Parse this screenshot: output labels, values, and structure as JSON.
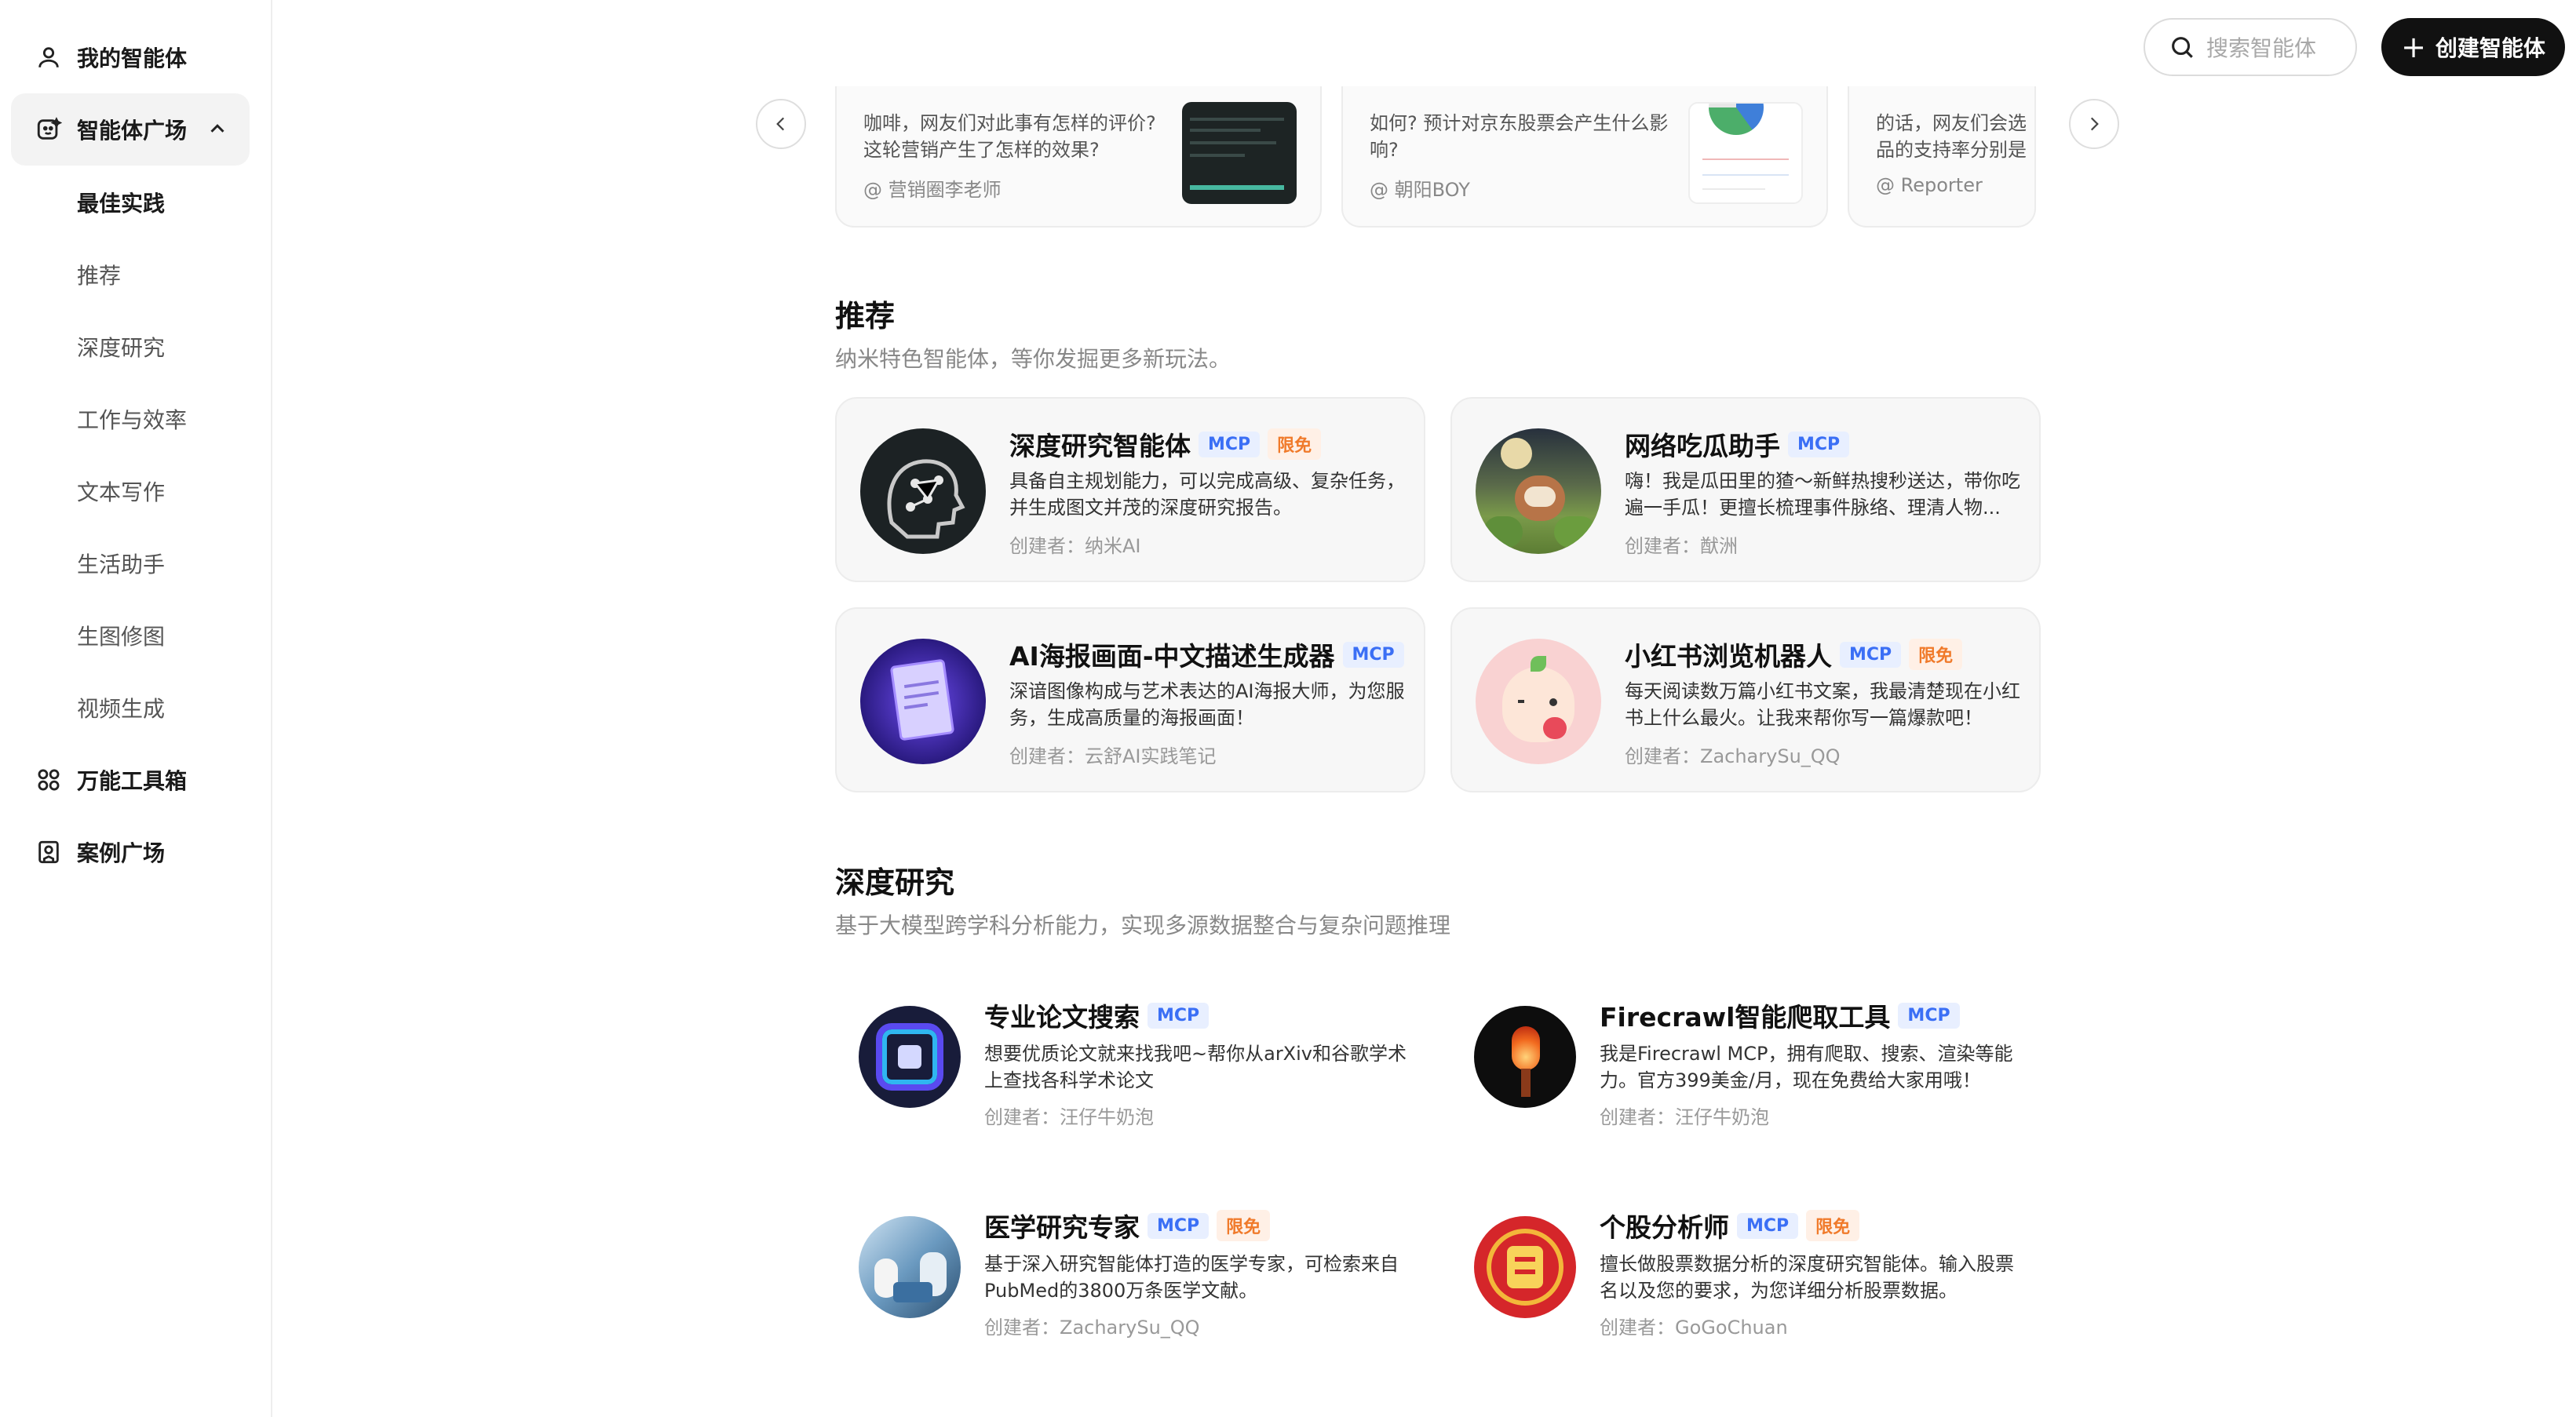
{
  "sidebar": {
    "my_agents": "我的智能体",
    "agent_square": "智能体广场",
    "sub_items": [
      "最佳实践",
      "推荐",
      "深度研究",
      "工作与效率",
      "文本写作",
      "生活助手",
      "生图修图",
      "视频生成"
    ],
    "toolbox": "万能工具箱",
    "case_square": "案例广场"
  },
  "header": {
    "search_placeholder": "搜索智能体",
    "create_label": "创建智能体"
  },
  "carousel": {
    "cards": [
      {
        "text_lines": [
          "咖啡，网友们对此事有怎样的评价?",
          "这轮营销产生了怎样的效果?"
        ],
        "author": "@ 营销圈李老师"
      },
      {
        "text_lines": [
          "如何? 预计对京东股票会产生什么影",
          "响?"
        ],
        "author": "@ 朝阳BOY"
      },
      {
        "text_lines": [
          "的话，网友们会选",
          "品的支持率分别是"
        ],
        "author": "@ Reporter"
      }
    ]
  },
  "recommend": {
    "title": "推荐",
    "subtitle": "纳米特色智能体，等你发掘更多新玩法。",
    "cards": [
      {
        "title": "深度研究智能体",
        "tags": [
          "MCP",
          "限免"
        ],
        "desc": "具备自主规划能力，可以完成高级、复杂任务，并生成图文并茂的深度研究报告。",
        "author": "创建者：纳米AI"
      },
      {
        "title": "网络吃瓜助手",
        "tags": [
          "MCP"
        ],
        "desc": "嗨！我是瓜田里的猹～新鲜热搜秒送达，带你吃遍一手瓜！更擅长梳理事件脉络、理清人物...",
        "author": "创建者：猷洲"
      },
      {
        "title": "AI海报画面-中文描述生成器",
        "tags": [
          "MCP"
        ],
        "desc": "深谙图像构成与艺术表达的AI海报大师，为您服务，生成高质量的海报画面！",
        "author": "创建者：云舒AI实践笔记"
      },
      {
        "title": "小红书浏览机器人",
        "tags": [
          "MCP",
          "限免"
        ],
        "desc": "每天阅读数万篇小红书文案，我最清楚现在小红书上什么最火。让我来帮你写一篇爆款吧！",
        "author": "创建者：ZacharySu_QQ"
      }
    ]
  },
  "deep_research": {
    "title": "深度研究",
    "subtitle": "基于大模型跨学科分析能力，实现多源数据整合与复杂问题推理",
    "cards": [
      {
        "title": "专业论文搜索",
        "tags": [
          "MCP"
        ],
        "desc": "想要优质论文就来找我吧~帮你从arXiv和谷歌学术上查找各科学术论文",
        "author": "创建者：汪仔牛奶泡"
      },
      {
        "title": "Firecrawl智能爬取工具",
        "tags": [
          "MCP"
        ],
        "desc": "我是Firecrawl MCP，拥有爬取、搜索、渲染等能力。官方399美金/月，现在免费给大家用哦！",
        "author": "创建者：汪仔牛奶泡"
      },
      {
        "title": "医学研究专家",
        "tags": [
          "MCP",
          "限免"
        ],
        "desc": "基于深入研究智能体打造的医学专家，可检索来自PubMed的3800万条医学文献。",
        "author": "创建者：ZacharySu_QQ"
      },
      {
        "title": "个股分析师",
        "tags": [
          "MCP",
          "限免"
        ],
        "desc": "擅长做股票数据分析的深度研究智能体。输入股票名以及您的要求，为您详细分析股票数据。",
        "author": "创建者：GoGoChuan"
      }
    ]
  },
  "colors": {
    "mcp": "#3b6ff5",
    "free": "#f07a2a",
    "accent": "#111111"
  }
}
